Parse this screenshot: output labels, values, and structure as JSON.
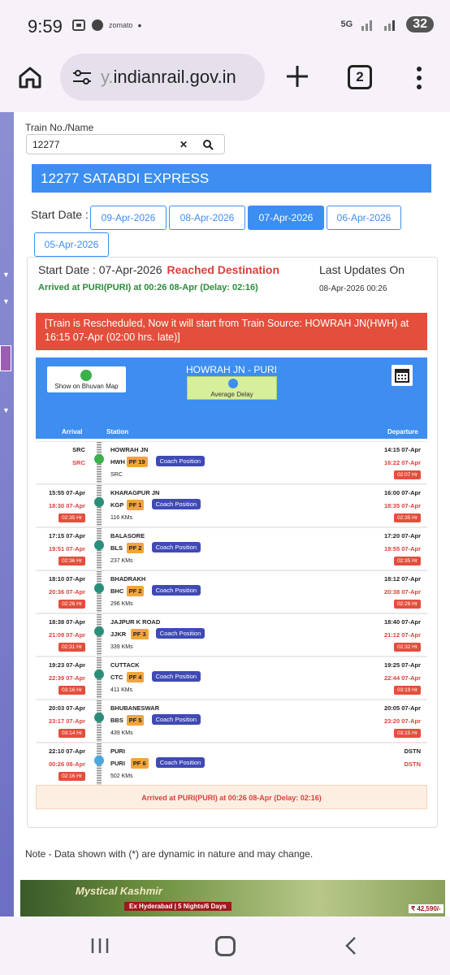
{
  "status_bar": {
    "time": "9:59",
    "app_label": "zomato",
    "network": "5G",
    "battery": "32"
  },
  "browser": {
    "url_faded": "y.",
    "url": "indianrail.gov.in",
    "tab_count": "2"
  },
  "form": {
    "train_label": "Train No./Name",
    "train_value": "12277",
    "clear": "✕",
    "search": "🔍"
  },
  "train_title": "12277 SATABDI EXPRESS",
  "start_date_label": "Start Date :",
  "dates": [
    "09-Apr-2026",
    "08-Apr-2026",
    "07-Apr-2026",
    "06-Apr-2026",
    "05-Apr-2026"
  ],
  "selected_date": "07-Apr-2026",
  "status": {
    "start_date_text": "Start Date : 07-Apr-2026",
    "reached": "Reached Destination",
    "arrived_text": "Arrived at PURI(PURI) at 00:26 08-Apr (Delay: 02:16)",
    "last_updates_label": "Last Updates On",
    "last_updates_value": "08-Apr-2026 00:26"
  },
  "reschedule_msg": "[Train is Rescheduled, Now it will start from Train Source: HOWRAH JN(HWH) at 16:15 07-Apr (02:00 hrs. late)]",
  "route": {
    "bhuvan_label": "Show on Bhuvan Map",
    "route_name": "HOWRAH JN - PURI",
    "avg_delay_label": "Average Delay",
    "col_arrival": "Arrival",
    "col_station": "Station",
    "col_departure": "Departure"
  },
  "stations": [
    {
      "name": "HOWRAH JN",
      "code": "HWH",
      "pf": "PF 19",
      "coach": "Coach Position",
      "km": "SRC",
      "arr_sched": "SRC",
      "arr_actual": "SRC",
      "arr_delay": "",
      "dep_sched": "14:15 07-Apr",
      "dep_actual": "16:22 07-Apr",
      "dep_delay": "02:07 Hr",
      "type": "src"
    },
    {
      "name": "KHARAGPUR JN",
      "code": "KGP",
      "pf": "PF 1",
      "coach": "Coach Position",
      "km": "116 KMs",
      "arr_sched": "15:55 07-Apr",
      "arr_actual": "18:30 07-Apr",
      "arr_delay": "02:35 Hr",
      "dep_sched": "16:00 07-Apr",
      "dep_actual": "18:35 07-Apr",
      "dep_delay": "02:35 Hr",
      "type": "mid"
    },
    {
      "name": "BALASORE",
      "code": "BLS",
      "pf": "PF 2",
      "coach": "Coach Position",
      "km": "237 KMs",
      "arr_sched": "17:15 07-Apr",
      "arr_actual": "19:51 07-Apr",
      "arr_delay": "02:36 Hr",
      "dep_sched": "17:20 07-Apr",
      "dep_actual": "19:55 07-Apr",
      "dep_delay": "02:35 Hr",
      "type": "mid"
    },
    {
      "name": "BHADRAKH",
      "code": "BHC",
      "pf": "PF 2",
      "coach": "Coach Position",
      "km": "296 KMs",
      "arr_sched": "18:10 07-Apr",
      "arr_actual": "20:36 07-Apr",
      "arr_delay": "02:26 Hr",
      "dep_sched": "18:12 07-Apr",
      "dep_actual": "20:38 07-Apr",
      "dep_delay": "02:26 Hr",
      "type": "mid"
    },
    {
      "name": "JAJPUR K ROAD",
      "code": "JJKR",
      "pf": "PF 3",
      "coach": "Coach Position",
      "km": "339 KMs",
      "arr_sched": "18:38 07-Apr",
      "arr_actual": "21:09 07-Apr",
      "arr_delay": "02:31 Hr",
      "dep_sched": "18:40 07-Apr",
      "dep_actual": "21:12 07-Apr",
      "dep_delay": "02:32 Hr",
      "type": "mid"
    },
    {
      "name": "CUTTACK",
      "code": "CTC",
      "pf": "PF 4",
      "coach": "Coach Position",
      "km": "411 KMs",
      "arr_sched": "19:23 07-Apr",
      "arr_actual": "22:39 07-Apr",
      "arr_delay": "03:16 Hr",
      "dep_sched": "19:25 07-Apr",
      "dep_actual": "22:44 07-Apr",
      "dep_delay": "03:19 Hr",
      "type": "mid"
    },
    {
      "name": "BHUBANESWAR",
      "code": "BBS",
      "pf": "PF 5",
      "coach": "Coach Position",
      "km": "439 KMs",
      "arr_sched": "20:03 07-Apr",
      "arr_actual": "23:17 07-Apr",
      "arr_delay": "03:14 Hr",
      "dep_sched": "20:05 07-Apr",
      "dep_actual": "23:20 07-Apr",
      "dep_delay": "03:15 Hr",
      "type": "mid"
    },
    {
      "name": "PURI",
      "code": "PURI",
      "pf": "PF 6",
      "coach": "Coach Position",
      "km": "502 KMs",
      "arr_sched": "22:10 07-Apr",
      "arr_actual": "00:26 08-Apr",
      "arr_delay": "02:16 Hr",
      "dep_sched": "DSTN",
      "dep_actual": "DSTN",
      "dep_delay": "",
      "type": "dst"
    }
  ],
  "footer_arrived": "Arrived at PURI(PURI) at 00:26 08-Apr (Delay: 02:16)",
  "note": "Note - Data shown with (*) are dynamic in nature and may change.",
  "ad": {
    "title": "Mystical Kashmir",
    "subtitle": "Ex Hyderabad | 5 Nights/6 Days",
    "price": "₹ 42,590/-"
  },
  "colors": {
    "primary": "#3d8ef0",
    "danger": "#e34f3c",
    "success": "#2e8b3a",
    "pf": "#f3a43b",
    "coach": "#3f4ab5"
  }
}
